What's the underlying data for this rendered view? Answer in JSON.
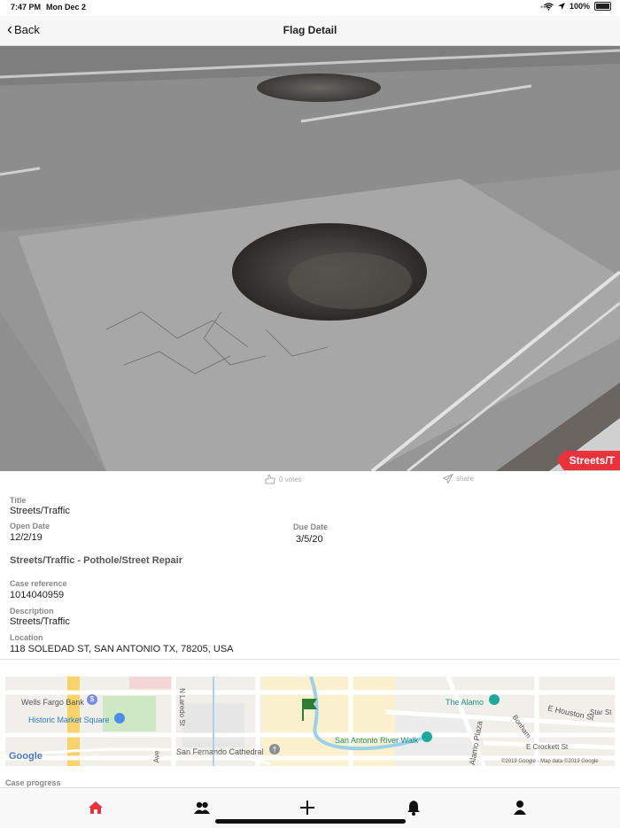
{
  "status_bar": {
    "time": "7:47 PM",
    "date": "Mon Dec 2",
    "battery": "100%"
  },
  "nav": {
    "back_label": "Back",
    "title": "Flag Detail"
  },
  "photo": {
    "category_tag": "Streets/T"
  },
  "actions": {
    "votes": "0 votes",
    "share": "share"
  },
  "details": {
    "title_label": "Title",
    "title_value": "Streets/Traffic",
    "open_date_label": "Open Date",
    "open_date_value": "12/2/19",
    "due_date_label": "Due Date",
    "due_date_value": "3/5/20",
    "subject": "Streets/Traffic - Pothole/Street Repair",
    "case_ref_label": "Case reference",
    "case_ref_value": "1014040959",
    "description_label": "Description",
    "description_value": "Streets/Traffic",
    "location_label": "Location",
    "location_value": "118 SOLEDAD ST, SAN ANTONIO TX, 78205, USA"
  },
  "map": {
    "labels": {
      "wells_fargo": "Wells Fargo Bank",
      "historic_market": "Historic Market Square",
      "san_fernando": "San Fernando Cathedral",
      "alamo": "The Alamo",
      "river_walk": "San Antonio River Walk",
      "alamo_plaza": "Alamo Plaza",
      "e_houston": "E Houston St",
      "e_crockett": "E Crockett St",
      "n_laredo": "N Laredo St",
      "bonham": "Bonham",
      "star_st": "Star St",
      "ave": "Ave",
      "logo": "Google",
      "attribution": "©2019 Google - Map data ©2019 Google"
    }
  },
  "case_progress_label": "Case progress",
  "tabs": [
    "home-icon",
    "community-icon",
    "add-icon",
    "notifications-icon",
    "profile-icon"
  ],
  "colors": {
    "accent": "#e8323c",
    "flag": "#2e7d32"
  }
}
